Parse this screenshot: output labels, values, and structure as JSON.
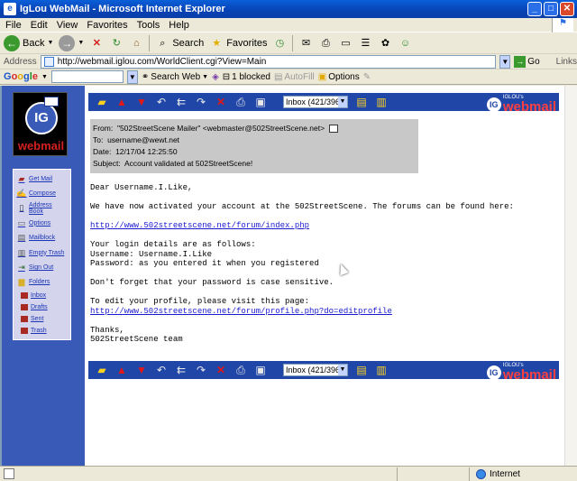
{
  "window": {
    "title": "IgLou WebMail - Microsoft Internet Explorer",
    "min": "_",
    "max": "□",
    "close": "✕"
  },
  "menu": [
    "File",
    "Edit",
    "View",
    "Favorites",
    "Tools",
    "Help"
  ],
  "toolbar": {
    "back": "Back",
    "search": "Search",
    "favorites": "Favorites"
  },
  "address": {
    "label": "Address",
    "url": "http://webmail.iglou.com/WorldClient.cgi?View=Main",
    "go": "Go",
    "links": "Links"
  },
  "googlebar": {
    "search_web": "Search Web",
    "blocked": "1 blocked",
    "autofill": "AutoFill",
    "options": "Options"
  },
  "sidebar": {
    "logo_text": "webmail",
    "logo_mark": "IG",
    "items": [
      {
        "label": "Get Mail",
        "icon": "mailbox-icon"
      },
      {
        "label": "Compose",
        "icon": "pen-icon"
      },
      {
        "label": "Address Book",
        "icon": "address-book-icon"
      },
      {
        "label": "Options",
        "icon": "options-icon"
      },
      {
        "label": "Mailblock",
        "icon": "mailblock-icon"
      },
      {
        "label": "Empty Trash",
        "icon": "trash-icon"
      },
      {
        "label": "Sign Out",
        "icon": "sign-out-icon"
      },
      {
        "label": "Folders",
        "icon": "folder-icon"
      }
    ],
    "folders": [
      "Inbox",
      "Drafts",
      "Sent",
      "Trash"
    ]
  },
  "mailbar": {
    "inbox_select": "Inbox (421/396)",
    "brand_small": "IGLOU's",
    "brand_big": "webmail",
    "brand_mark": "IG"
  },
  "message": {
    "from_label": "From:",
    "from": "\"502StreetScene Mailer\" <webmaster@502StreetScene.net>",
    "to_label": "To:",
    "to": "username@wewt.net",
    "date_label": "Date:",
    "date": "12/17/04 12:25:50",
    "subject_label": "Subject:",
    "subject": "Account validated at 502StreetScene!",
    "greeting": "Dear Username.I.Like,",
    "line1": "We have now activated your account at the 502StreetScene. The forums can be found here:",
    "forum_link": "http://www.502streetscene.net/forum/index.php",
    "login_intro": "Your login details are as follows:",
    "username_line": "Username: Username.I.Like",
    "password_line": "Password: as you entered it when you registered",
    "case_line": "Don't forget that your password is case sensitive.",
    "profile_intro": "To edit your profile, please visit this page:",
    "profile_link": "http://www.502streetscene.net/forum/profile.php?do=editprofile",
    "thanks": "Thanks,",
    "team": "502StreetScene team"
  },
  "status": {
    "zone": "Internet"
  }
}
